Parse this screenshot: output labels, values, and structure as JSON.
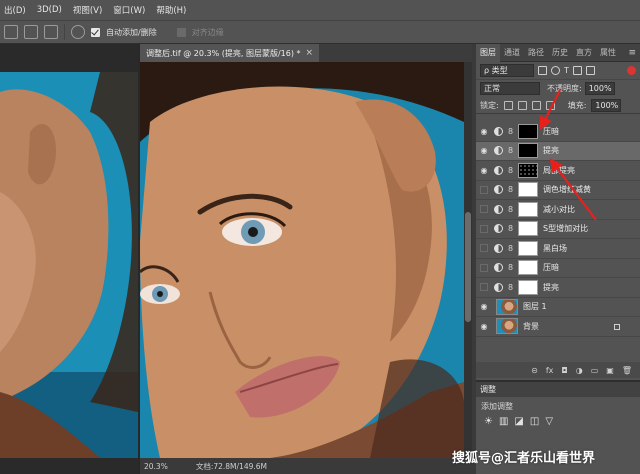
{
  "menubar": {
    "items": [
      "出(D)",
      "3D(D)",
      "视图(V)",
      "窗口(W)",
      "帮助(H)"
    ]
  },
  "options": {
    "auto_add_delete": "自动添加/删除",
    "align_edges": "对齐边缘"
  },
  "document": {
    "title": "调整后.tif @ 20.3% (提亮, 图层蒙版/16) *",
    "close": "×",
    "zoom": "20.3%",
    "doc_size": "文档:72.8M/149.6M"
  },
  "panel": {
    "tabs": [
      "图层",
      "通道",
      "路径",
      "历史",
      "直方",
      "属性"
    ],
    "filter_kind": "ρ 类型",
    "blend_mode": "正常",
    "opacity_label": "不透明度:",
    "opacity_value": "100%",
    "lock_label": "锁定:",
    "fill_label": "填充:",
    "fill_value": "100%",
    "bottom_icons": [
      "⊝",
      "fx",
      "◘",
      "◑",
      "▭",
      "▣",
      "🗑"
    ]
  },
  "layers": [
    {
      "name": "压暗",
      "visible": true,
      "mask": "black",
      "selected": false
    },
    {
      "name": "提亮",
      "visible": true,
      "mask": "black",
      "selected": true
    },
    {
      "name": "局部提亮",
      "visible": true,
      "mask": "dots",
      "selected": false
    },
    {
      "name": "调色增红减黄",
      "visible": false,
      "mask": "white",
      "selected": false
    },
    {
      "name": "减小对比",
      "visible": false,
      "mask": "white",
      "selected": false
    },
    {
      "name": "S型增加对比",
      "visible": false,
      "mask": "white",
      "selected": false
    },
    {
      "name": "黑白场",
      "visible": false,
      "mask": "white",
      "selected": false
    },
    {
      "name": "压暗",
      "visible": false,
      "mask": "white",
      "selected": false
    },
    {
      "name": "提亮",
      "visible": false,
      "mask": "white",
      "selected": false
    },
    {
      "name": "图层 1",
      "visible": true,
      "mask": "image",
      "selected": false
    },
    {
      "name": "背景",
      "visible": true,
      "mask": "image",
      "selected": false,
      "locked": true
    }
  ],
  "adjustments": {
    "tab": "调整",
    "title": "添加调整",
    "icons": [
      "☀",
      "▥",
      "◪",
      "◫",
      "▽"
    ]
  },
  "watermark": "搜狐号@汇者乐山看世界",
  "colors": {
    "accent_red": "#e8201c",
    "panel_bg": "#535353",
    "canvas_bg": "#282828"
  }
}
